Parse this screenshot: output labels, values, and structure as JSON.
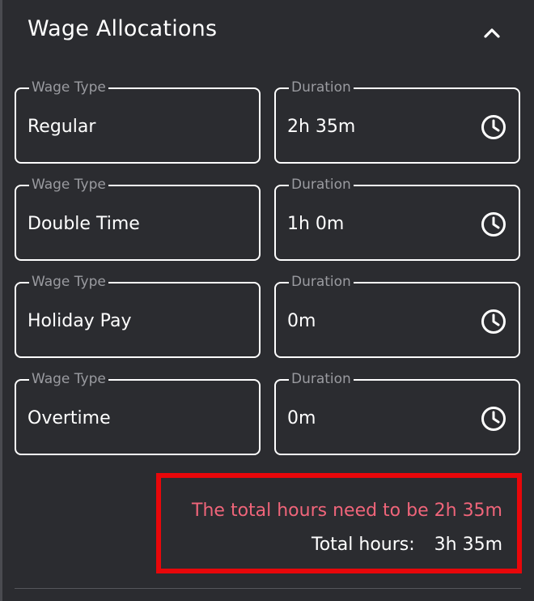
{
  "section": {
    "title": "Wage Allocations",
    "collapse_icon": "chevron-up-icon"
  },
  "allocations": [
    {
      "wage_type_label": "Wage Type",
      "wage_type": "Regular",
      "duration_label": "Duration",
      "duration": "2h 35m"
    },
    {
      "wage_type_label": "Wage Type",
      "wage_type": "Double Time",
      "duration_label": "Duration",
      "duration": "1h 0m"
    },
    {
      "wage_type_label": "Wage Type",
      "wage_type": "Holiday Pay",
      "duration_label": "Duration",
      "duration": "0m"
    },
    {
      "wage_type_label": "Wage Type",
      "wage_type": "Overtime",
      "duration_label": "Duration",
      "duration": "0m"
    }
  ],
  "summary": {
    "error_message": "The total hours need to be 2h 35m",
    "total_label": "Total hours:",
    "total_value": "3h 35m"
  },
  "colors": {
    "background": "#2b2c30",
    "error_text": "#f0657a",
    "highlight_border": "#e8070a"
  }
}
